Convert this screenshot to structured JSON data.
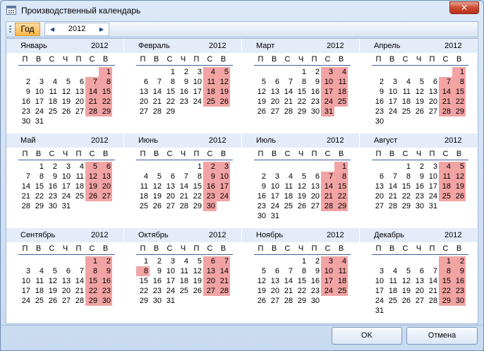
{
  "window": {
    "title": "Производственный календарь",
    "close_label": "✕"
  },
  "toolbar": {
    "year_button": "Год",
    "prev": "◀",
    "next": "▶",
    "year": "2012"
  },
  "weekday_headers": [
    "П",
    "В",
    "С",
    "Ч",
    "П",
    "С",
    "В"
  ],
  "colors": {
    "holiday": "#f2a3a3",
    "header": "#e3ecf8",
    "accent_button": "#f7b64b"
  },
  "months": [
    {
      "name": "Январь",
      "year": "2012",
      "offset": 6,
      "days": 31,
      "holidays": [
        1,
        7,
        8,
        14,
        15,
        21,
        22,
        28,
        29
      ]
    },
    {
      "name": "Февраль",
      "year": "2012",
      "offset": 2,
      "days": 29,
      "holidays": [
        4,
        5,
        11,
        12,
        18,
        19,
        25,
        26
      ]
    },
    {
      "name": "Март",
      "year": "2012",
      "offset": 3,
      "days": 31,
      "holidays": [
        3,
        4,
        10,
        11,
        17,
        18,
        24,
        25,
        31
      ]
    },
    {
      "name": "Апрель",
      "year": "2012",
      "offset": 6,
      "days": 30,
      "holidays": [
        1,
        7,
        8,
        14,
        15,
        21,
        22,
        28,
        29
      ]
    },
    {
      "name": "Май",
      "year": "2012",
      "offset": 1,
      "days": 31,
      "holidays": [
        5,
        6,
        12,
        13,
        19,
        20,
        26,
        27
      ]
    },
    {
      "name": "Июнь",
      "year": "2012",
      "offset": 4,
      "days": 30,
      "holidays": [
        2,
        3,
        9,
        10,
        16,
        17,
        23,
        24,
        30
      ]
    },
    {
      "name": "Июль",
      "year": "2012",
      "offset": 6,
      "days": 31,
      "holidays": [
        1,
        7,
        8,
        14,
        15,
        21,
        22,
        28,
        29
      ]
    },
    {
      "name": "Август",
      "year": "2012",
      "offset": 2,
      "days": 31,
      "holidays": [
        4,
        5,
        11,
        12,
        18,
        19,
        25,
        26
      ]
    },
    {
      "name": "Сентябрь",
      "year": "2012",
      "offset": 5,
      "days": 30,
      "holidays": [
        1,
        2,
        8,
        9,
        15,
        16,
        22,
        23,
        29,
        30
      ]
    },
    {
      "name": "Октябрь",
      "year": "2012",
      "offset": 0,
      "days": 31,
      "holidays": [
        6,
        7,
        8,
        13,
        14,
        20,
        21,
        27,
        28
      ]
    },
    {
      "name": "Ноябрь",
      "year": "2012",
      "offset": 3,
      "days": 30,
      "holidays": [
        3,
        4,
        10,
        11,
        17,
        18,
        24,
        25
      ]
    },
    {
      "name": "Декабрь",
      "year": "2012",
      "offset": 5,
      "days": 31,
      "holidays": [
        1,
        2,
        8,
        9,
        15,
        16,
        22,
        23,
        29,
        30
      ]
    }
  ],
  "buttons": {
    "ok": "OK",
    "cancel": "Отмена"
  }
}
